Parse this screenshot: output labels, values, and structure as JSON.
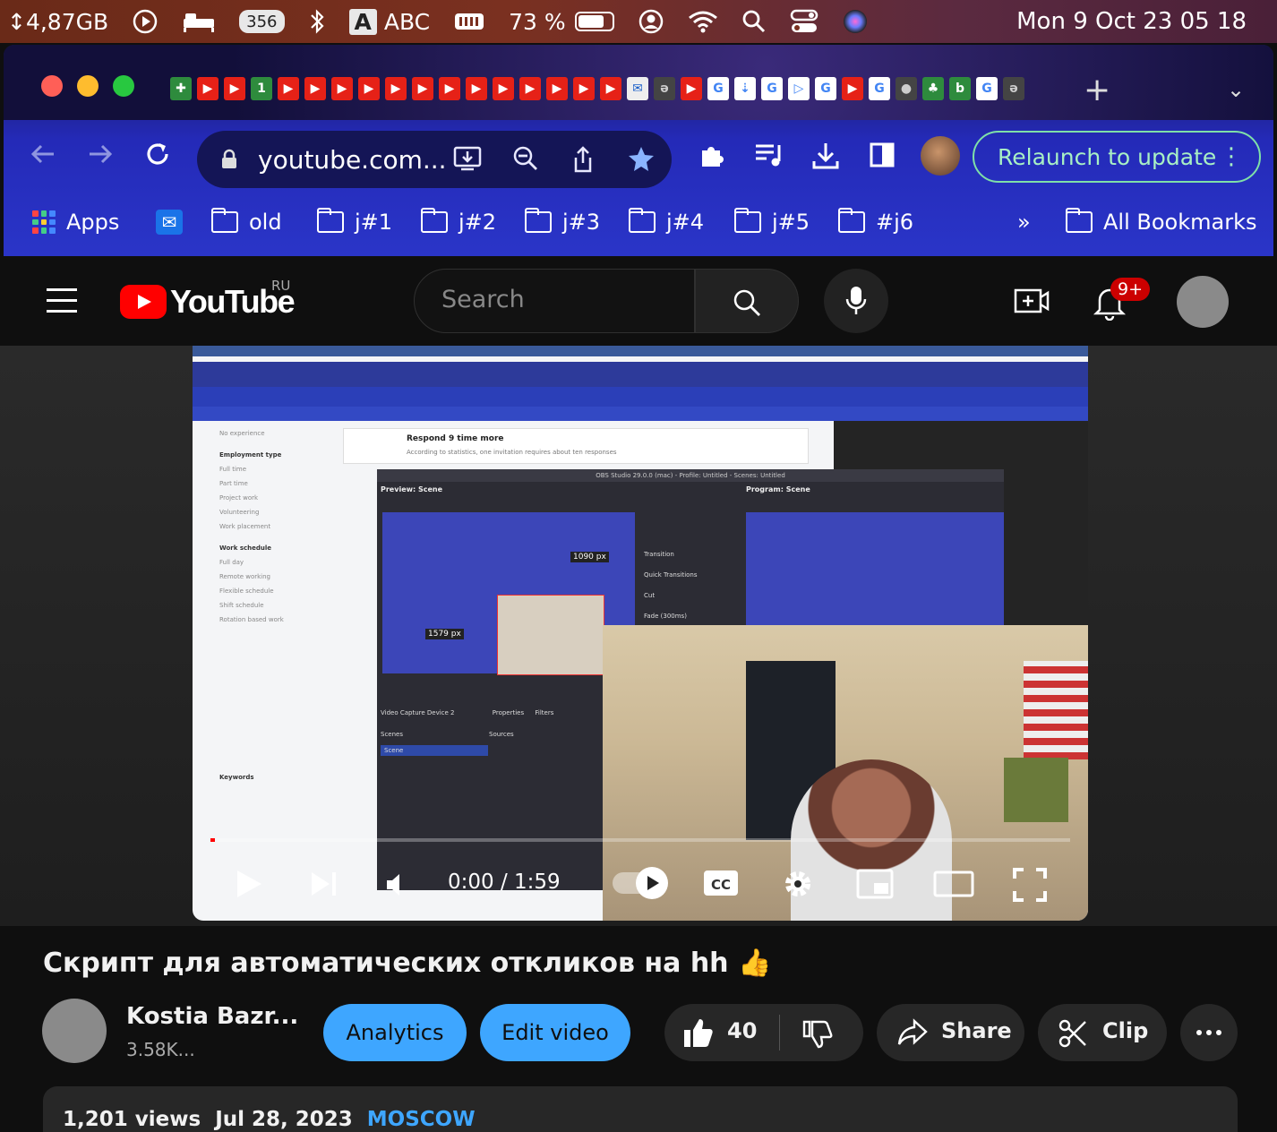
{
  "menubar": {
    "storage": "↕4,87GB",
    "badge_count": "356",
    "input_letter": "A",
    "input_name": "ABC",
    "battery": "73 %",
    "datetime": "Mon 9 Oct  23 05 18"
  },
  "chrome": {
    "url": "youtube.com...",
    "relaunch_label": "Relaunch to update",
    "bookmarks": {
      "apps": "Apps",
      "folders": [
        "old",
        "j#1",
        "j#2",
        "j#3",
        "j#4",
        "j#5",
        "#j6"
      ],
      "overflow": "»",
      "all": "All Bookmarks"
    }
  },
  "youtube": {
    "logo_text": "YouTube",
    "region": "RU",
    "search_placeholder": "Search",
    "notif_badge": "9+",
    "player": {
      "time": "0:00 / 1:59",
      "progress": 0.005
    },
    "video": {
      "title": "Скрипт для автоматических откликов на hh 👍",
      "channel_name": "Kostia Bazr...",
      "subscribers": "3.58K...",
      "analytics_label": "Analytics",
      "edit_label": "Edit video",
      "likes": "40",
      "share_label": "Share",
      "clip_label": "Clip",
      "views": "1,201 views",
      "date": "Jul 28, 2023",
      "location": "MOSCOW"
    },
    "embedded_frame_text": {
      "obs_title": "OBS Studio 29.0.0 (mac) - Profile: Untitled - Scenes: Untitled",
      "preview": "Preview: Scene",
      "program": "Program: Scene",
      "respond": "Respond 9 time more",
      "respond_sub": "According to statistics, one invitation requires about ten responses",
      "side_labels": [
        "No experience",
        "Employment type",
        "Full time",
        "Part time",
        "Project work",
        "Volunteering",
        "Work placement",
        "Work schedule",
        "Full day",
        "Remote working",
        "Flexible schedule",
        "Shift schedule",
        "Rotation based work",
        "Keywords"
      ],
      "transition": "Transition",
      "quick_transitions": "Quick Transitions",
      "cut": "Cut",
      "fade": "Fade (300ms)",
      "capture": "Video Capture Device 2",
      "properties": "Properties",
      "filters": "Filters",
      "scenes": "Scenes",
      "sources": "Sources",
      "scene": "Scene",
      "px1": "1090 px",
      "px2": "1579 px"
    }
  }
}
